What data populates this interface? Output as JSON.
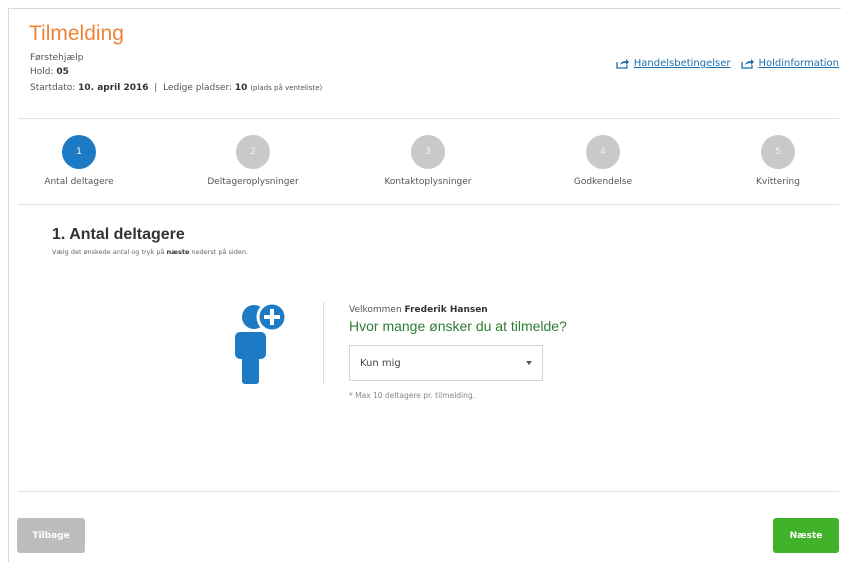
{
  "header": {
    "title": "Tilmelding",
    "course": "Førstehjælp",
    "hold_label": "Hold:",
    "hold_value": "05",
    "start_label": "Startdato:",
    "start_value": "10. april 2016",
    "sep": "|",
    "seats_label": "Ledige pladser:",
    "seats_value": "10",
    "seats_note": "(plads på venteliste)",
    "links": [
      {
        "label": "Handelsbetingelser",
        "icon": "share-icon"
      },
      {
        "label": "Holdinformation",
        "icon": "share-icon"
      }
    ]
  },
  "steps": [
    {
      "num": "1",
      "label": "Antal deltagere",
      "active": true
    },
    {
      "num": "2",
      "label": "Deltageroplysninger",
      "active": false
    },
    {
      "num": "3",
      "label": "Kontaktoplysninger",
      "active": false
    },
    {
      "num": "4",
      "label": "Godkendelse",
      "active": false
    },
    {
      "num": "5",
      "label": "Kvittering",
      "active": false
    }
  ],
  "section": {
    "title": "1.  Antal deltagere",
    "subtitle_pre": "Vælg det ønskede antal og tryk på ",
    "subtitle_bold": "næste",
    "subtitle_post": " nederst på siden."
  },
  "form": {
    "welcome_pre": "Velkommen ",
    "welcome_name": "Frederik Hansen",
    "question": "Hvor mange ønsker du at tilmelde?",
    "select_value": "Kun mig",
    "note": "* Max 10 deltagere pr. tilmelding."
  },
  "buttons": {
    "back": "Tilbage",
    "next": "Næste"
  },
  "colors": {
    "title": "#f0833a",
    "active_step": "#1d7bc6",
    "inactive_step": "#c9c9c9",
    "question": "#2e7d32",
    "next_button": "#43b22b",
    "back_button": "#bdbdbd",
    "icon": "#1d7bc6"
  }
}
